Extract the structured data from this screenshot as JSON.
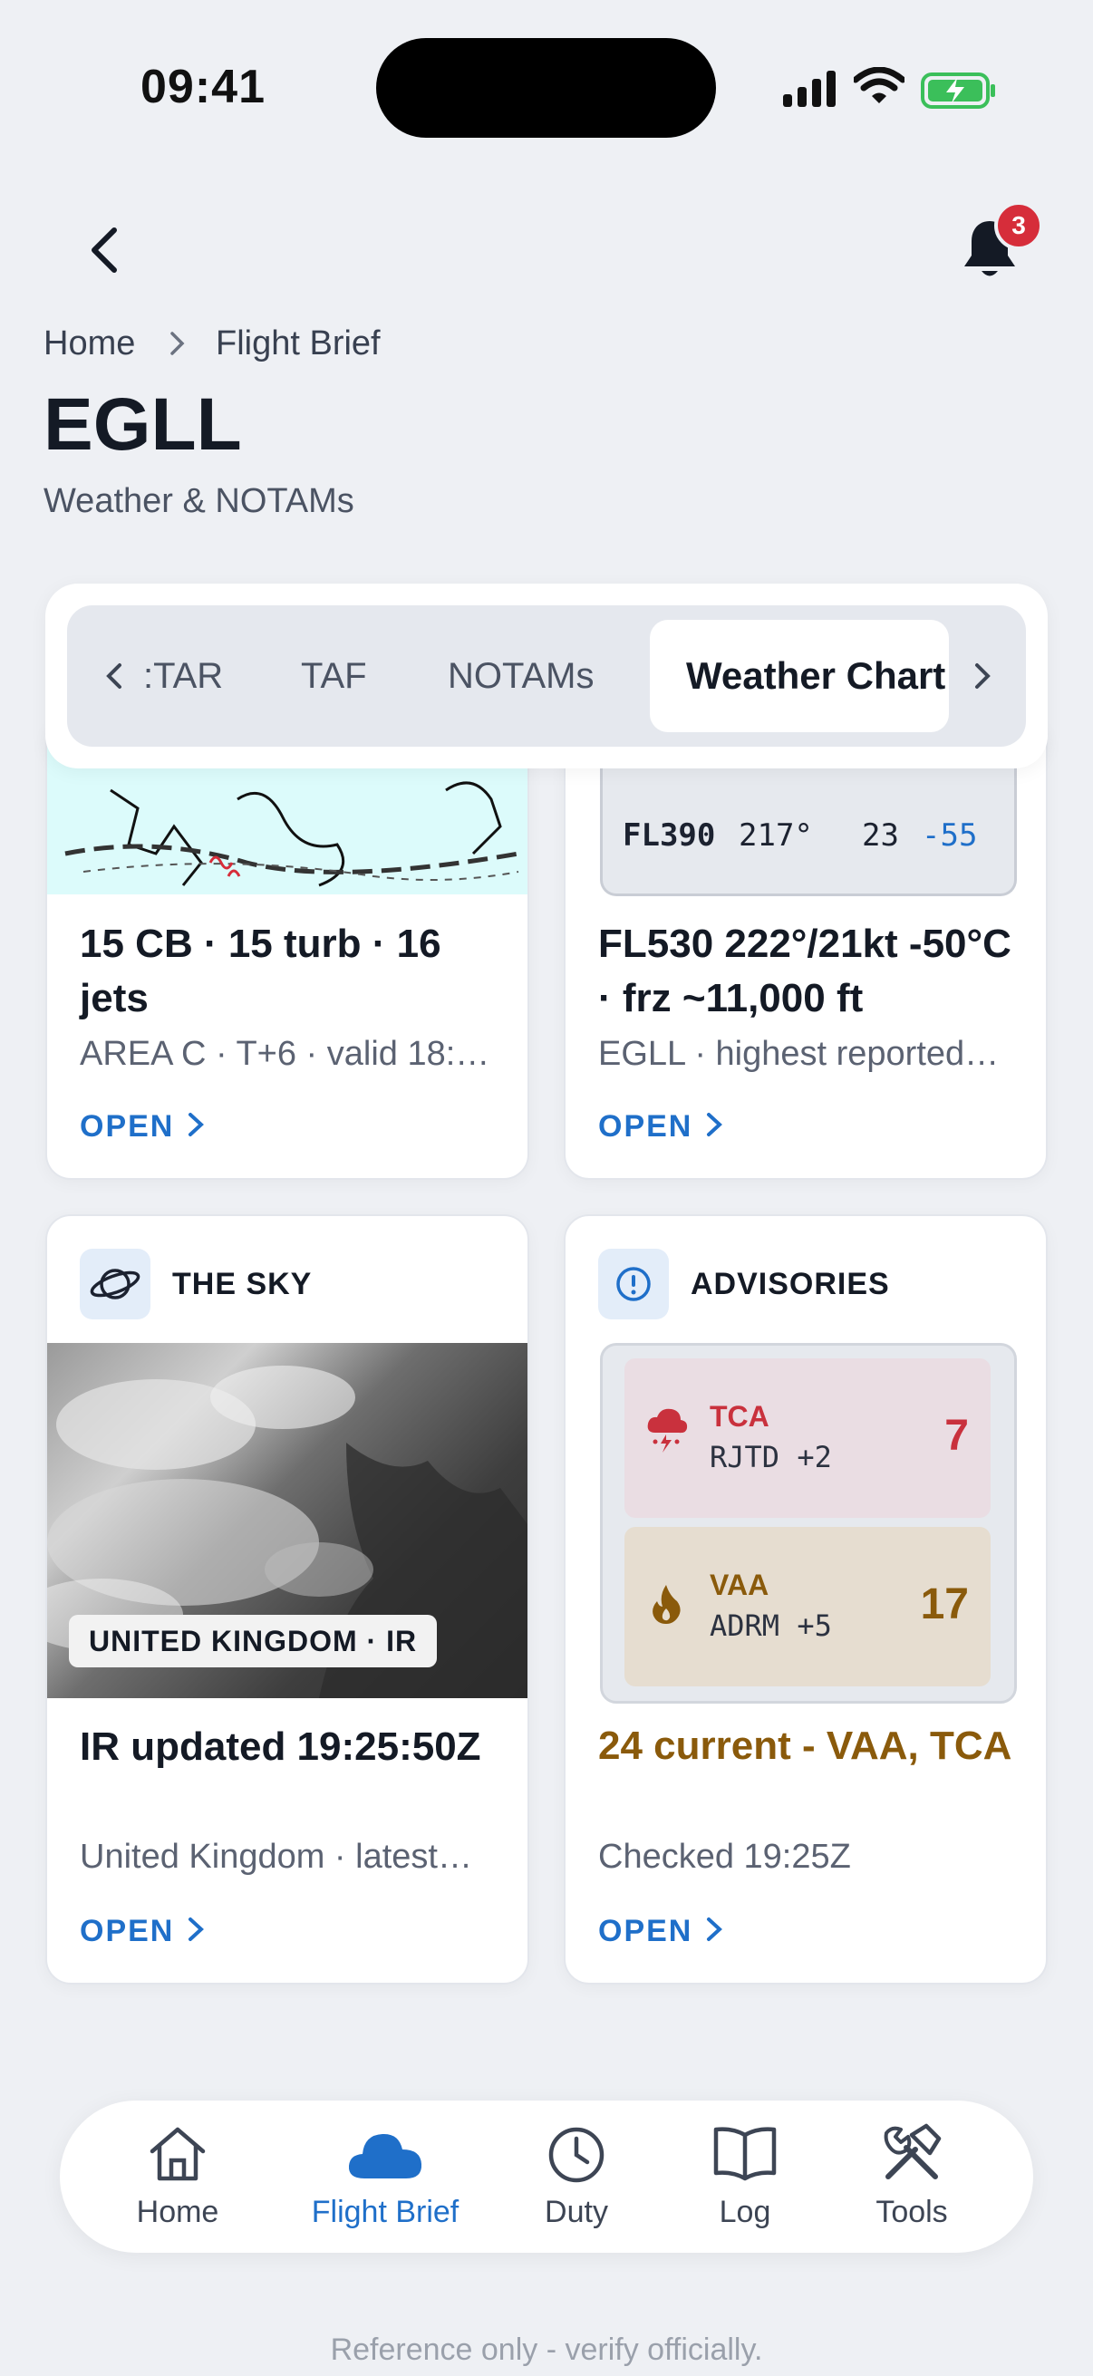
{
  "status": {
    "time": "09:41"
  },
  "header": {
    "notification_count": "3"
  },
  "breadcrumb": {
    "home": "Home",
    "current": "Flight Brief"
  },
  "page": {
    "title": "EGLL",
    "subtitle": "Weather & NOTAMs"
  },
  "tabs": [
    {
      "label": "METAR",
      "visible": ":TAR"
    },
    {
      "label": "TAF"
    },
    {
      "label": "NOTAMs"
    },
    {
      "label": "Weather Charts",
      "visible": "Weather Chart",
      "active": true
    }
  ],
  "cards": {
    "sigwx": {
      "title": "15 CB · 15 turb · 16 jets",
      "subtitle": "AREA C · T+6 · valid 18:…",
      "open": "OPEN"
    },
    "winds": {
      "row": {
        "level": "FL390",
        "dir": "217°",
        "speed": "23",
        "temp": "-55"
      },
      "title": "FL530 222°/21kt -50°C · frz ~11,000 ft",
      "subtitle": "EGLL · highest reported…",
      "open": "OPEN"
    },
    "sky": {
      "header": "THE SKY",
      "image_label": "UNITED KINGDOM · IR",
      "title": "IR updated 19:25:50Z",
      "subtitle": "United Kingdom · latest…",
      "open": "OPEN"
    },
    "advisories": {
      "header": "ADVISORIES",
      "items": [
        {
          "type": "TCA",
          "station": "RJTD +2",
          "count": "7",
          "color": "#c9313d"
        },
        {
          "type": "VAA",
          "station": "ADRM +5",
          "count": "17",
          "color": "#8a5a0b"
        }
      ],
      "summary": "24 current - VAA, TCA",
      "checked": "Checked 19:25Z",
      "open": "OPEN"
    }
  },
  "nav": [
    {
      "label": "Home",
      "icon": "home-icon"
    },
    {
      "label": "Flight Brief",
      "icon": "cloud-icon",
      "active": true
    },
    {
      "label": "Duty",
      "icon": "clock-icon"
    },
    {
      "label": "Log",
      "icon": "book-icon"
    },
    {
      "label": "Tools",
      "icon": "tools-icon"
    }
  ],
  "footer": "Reference only - verify officially.",
  "colors": {
    "accent": "#1f6fc9",
    "badge": "#d62d3a",
    "tca": "#c9313d",
    "vaa": "#8a5a0b"
  }
}
